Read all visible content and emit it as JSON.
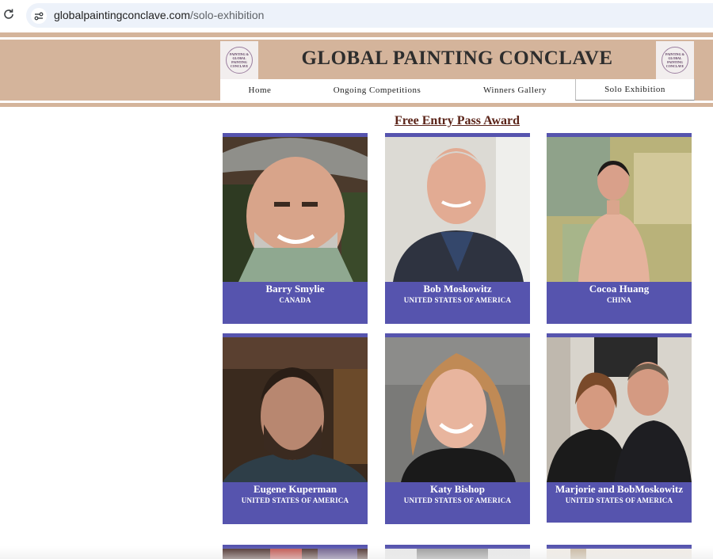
{
  "browser": {
    "url_domain": "globalpaintingconclave.com",
    "url_path": "/solo-exhibition",
    "reload_icon": "reload-icon",
    "site_info_icon": "site-info-icon"
  },
  "site": {
    "title": "GLOBAL PAINTING CONCLAVE",
    "logo_text": "PAINTING & GLOBAL PAINTING CONCLAVE",
    "header_color": "#d4b49b"
  },
  "nav": {
    "items": [
      "Home",
      "Ongoing Competitions",
      "Winners Gallery",
      "Solo Exhibition"
    ],
    "active": "Solo Exhibition"
  },
  "section": {
    "heading": "Free Entry Pass Award",
    "card_color": "#5654ae"
  },
  "artists": [
    {
      "name": "Barry Smylie",
      "country": "CANADA"
    },
    {
      "name": "Bob Moskowitz",
      "country": "UNITED STATES OF AMERICA"
    },
    {
      "name": "Cocoa Huang",
      "country": "CHINA"
    },
    {
      "name": "Eugene Kuperman",
      "country": "UNITED STATES OF AMERICA"
    },
    {
      "name": "Katy Bishop",
      "country": "UNITED STATES OF AMERICA"
    },
    {
      "name": "Marjorie and BobMoskowitz",
      "country": "UNITED STATES OF AMERICA"
    }
  ]
}
